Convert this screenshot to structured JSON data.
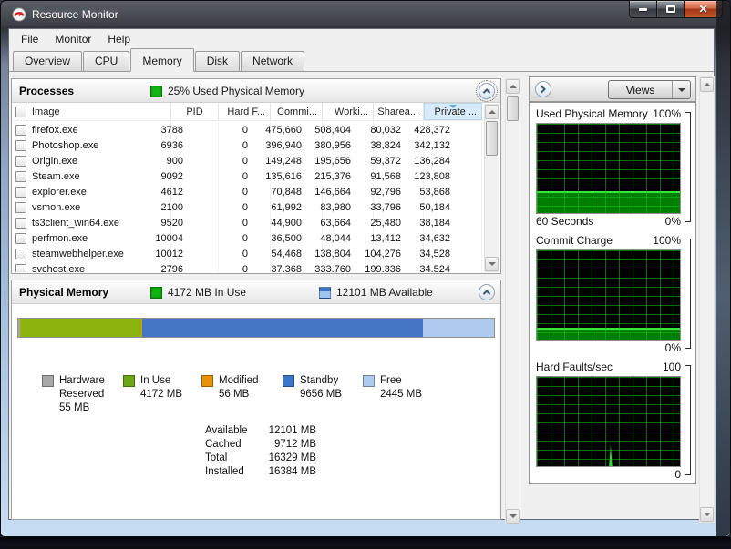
{
  "window": {
    "title": "Resource Monitor"
  },
  "menu": {
    "items": [
      "File",
      "Monitor",
      "Help"
    ]
  },
  "tabs": {
    "items": [
      "Overview",
      "CPU",
      "Memory",
      "Disk",
      "Network"
    ],
    "selected": "Memory"
  },
  "processes": {
    "title": "Processes",
    "status": "25% Used Physical Memory",
    "columns": [
      "Image",
      "PID",
      "Hard F...",
      "Commi...",
      "Worki...",
      "Sharea...",
      "Private ..."
    ],
    "sorted_column": "Private ...",
    "rows": [
      {
        "image": "firefox.exe",
        "pid": "3788",
        "hard_faults": "0",
        "commit": "475,660",
        "working_set": "508,404",
        "shareable": "80,032",
        "private": "428,372"
      },
      {
        "image": "Photoshop.exe",
        "pid": "6936",
        "hard_faults": "0",
        "commit": "396,940",
        "working_set": "380,956",
        "shareable": "38,824",
        "private": "342,132"
      },
      {
        "image": "Origin.exe",
        "pid": "900",
        "hard_faults": "0",
        "commit": "149,248",
        "working_set": "195,656",
        "shareable": "59,372",
        "private": "136,284"
      },
      {
        "image": "Steam.exe",
        "pid": "9092",
        "hard_faults": "0",
        "commit": "135,616",
        "working_set": "215,376",
        "shareable": "91,568",
        "private": "123,808"
      },
      {
        "image": "explorer.exe",
        "pid": "4612",
        "hard_faults": "0",
        "commit": "70,848",
        "working_set": "146,664",
        "shareable": "92,796",
        "private": "53,868"
      },
      {
        "image": "vsmon.exe",
        "pid": "2100",
        "hard_faults": "0",
        "commit": "61,992",
        "working_set": "83,980",
        "shareable": "33,796",
        "private": "50,184"
      },
      {
        "image": "ts3client_win64.exe",
        "pid": "9520",
        "hard_faults": "0",
        "commit": "44,900",
        "working_set": "63,664",
        "shareable": "25,480",
        "private": "38,184"
      },
      {
        "image": "perfmon.exe",
        "pid": "10004",
        "hard_faults": "0",
        "commit": "36,500",
        "working_set": "48,044",
        "shareable": "13,412",
        "private": "34,632"
      },
      {
        "image": "steamwebhelper.exe",
        "pid": "10012",
        "hard_faults": "0",
        "commit": "54,468",
        "working_set": "138,804",
        "shareable": "104,276",
        "private": "34,528"
      },
      {
        "image": "svchost.exe",
        "pid": "2796",
        "hard_faults": "0",
        "commit": "37,368",
        "working_set": "333,760",
        "shareable": "199,336",
        "private": "34,524"
      }
    ]
  },
  "physical_memory": {
    "title": "Physical Memory",
    "in_use_status": "4172 MB In Use",
    "available_status": "12101 MB Available",
    "bar": {
      "segments": [
        {
          "name": "hardware-reserved",
          "pct": 0.34,
          "color": "#a8a8a8"
        },
        {
          "name": "in-use",
          "pct": 25.46,
          "color": "#8cb20e"
        },
        {
          "name": "modified",
          "pct": 0.34,
          "color": "#e8920c"
        },
        {
          "name": "standby",
          "pct": 58.94,
          "color": "#4377c6"
        },
        {
          "name": "free",
          "pct": 14.92,
          "color": "#aecbef"
        }
      ]
    },
    "legend": [
      {
        "label": "Hardware Reserved",
        "value": "55 MB",
        "color": "#a8a8a8"
      },
      {
        "label": "In Use",
        "value": "4172 MB",
        "color": "#6ca616"
      },
      {
        "label": "Modified",
        "value": "56 MB",
        "color": "#e8920c"
      },
      {
        "label": "Standby",
        "value": "9656 MB",
        "color": "#3b76c8"
      },
      {
        "label": "Free",
        "value": "2445 MB",
        "color": "#aecbef"
      }
    ],
    "stats": [
      {
        "label": "Available",
        "value": "12101 MB"
      },
      {
        "label": "Cached",
        "value": "9712 MB"
      },
      {
        "label": "Total",
        "value": "16329 MB"
      },
      {
        "label": "Installed",
        "value": "16384 MB"
      }
    ]
  },
  "right_panel": {
    "views_button": "Views",
    "graphs": [
      {
        "title": "Used Physical Memory",
        "max_label": "100%",
        "min_label": "0%",
        "x_axis_label": "60 Seconds",
        "fill_percent": 25
      },
      {
        "title": "Commit Charge",
        "max_label": "100%",
        "min_label": "0%",
        "x_axis_label": "",
        "fill_percent": 13
      },
      {
        "title": "Hard Faults/sec",
        "max_label": "100",
        "min_label": "0",
        "x_axis_label": "",
        "fill_percent": 0,
        "spike": {
          "x_percent": 49,
          "height_percent": 24
        }
      }
    ]
  },
  "colors": {
    "status_swatch_green": "#12b412",
    "status_swatch_blue": "#9cc6ee",
    "sorted_header_bg": "#d9eaf9",
    "graph_fill_green": "#017d01",
    "graph_line_green": "#35e835"
  }
}
